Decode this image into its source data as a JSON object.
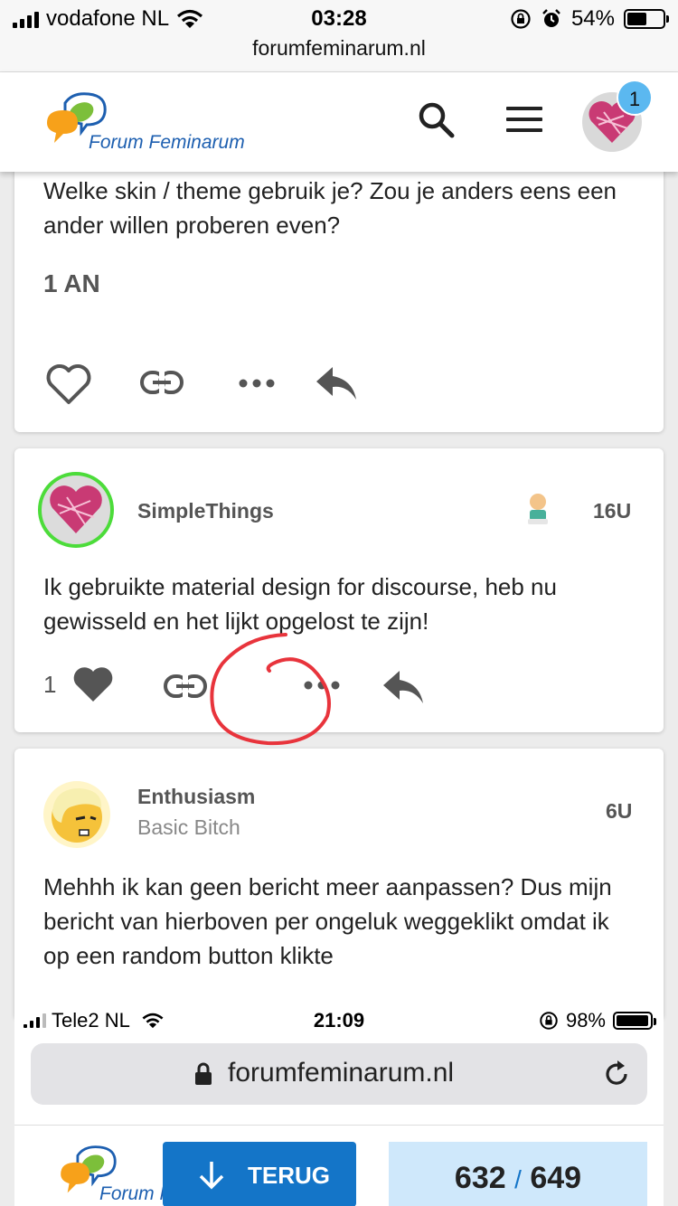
{
  "status_bar": {
    "carrier": "vodafone NL",
    "time": "03:28",
    "battery": "54%",
    "battery_fraction": 0.54
  },
  "browser": {
    "url": "forumfeminarum.nl"
  },
  "header": {
    "logo_text": "Forum Feminarum",
    "notification_count": "1"
  },
  "posts": [
    {
      "text": "Welke skin / theme gebruik je? Zou je anders eens een ander willen proberen even?",
      "truncated_label": "1 AN",
      "likes": ""
    },
    {
      "username": "SimpleThings",
      "age": "16U",
      "text": "Ik gebruikte material design for discourse, heb nu gewisseld en het lijkt opgelost te zijn!",
      "likes": "1"
    },
    {
      "username": "Enthusiasm",
      "user_title": "Basic Bitch",
      "age": "6U",
      "text": "Mehhh ik kan geen bericht meer aanpassen? Dus mijn bericht van hierboven per ongeluk weggeklikt omdat ik op een random button klikte"
    }
  ],
  "embedded_screenshot": {
    "carrier": "Tele2 NL",
    "time": "21:09",
    "battery": "98%",
    "battery_fraction": 0.98,
    "url": "forumfeminarum.nl",
    "logo_text": "Forum F",
    "back_button": "TERUG",
    "progress_current": "632",
    "progress_sep": "/",
    "progress_total": "649"
  },
  "colors": {
    "accent_blue": "#1475c8",
    "badge_blue": "#5bb8f0",
    "annotation_red": "#e8343c",
    "avatar_ring": "#4cdc3a"
  },
  "icons": [
    "signal-icon",
    "wifi-icon",
    "orientation-lock-icon",
    "alarm-icon",
    "battery-icon",
    "search-icon",
    "menu-icon",
    "heart-icon",
    "link-icon",
    "more-icon",
    "reply-icon",
    "lock-icon",
    "reload-icon",
    "arrow-down-icon"
  ]
}
